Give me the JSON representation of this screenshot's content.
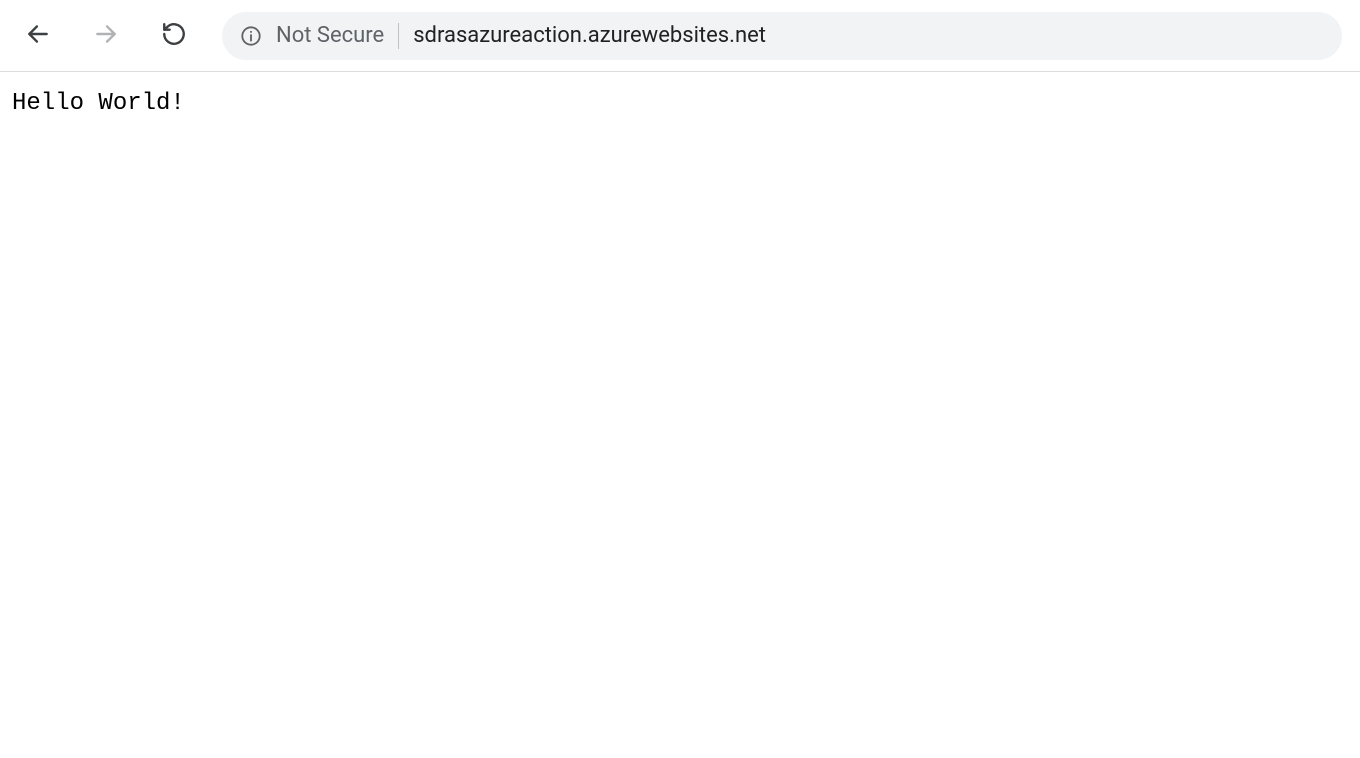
{
  "toolbar": {
    "security_label": "Not Secure",
    "url": "sdrasazureaction.azurewebsites.net"
  },
  "page": {
    "body_text": "Hello World!"
  }
}
